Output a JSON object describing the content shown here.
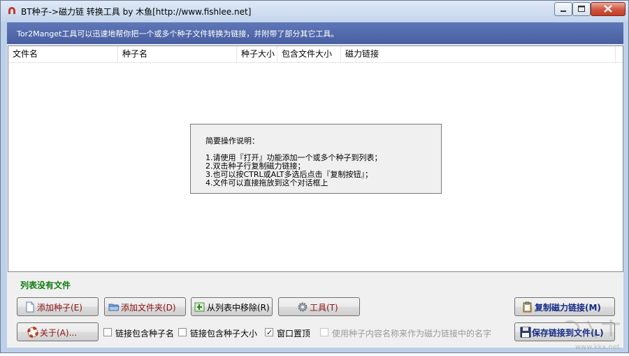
{
  "window": {
    "title": "BT种子->磁力链 转换工具 by 木鱼[http://www.fishlee.net]",
    "controls": {
      "minimize": "minimize",
      "maximize": "maximize",
      "close": "close"
    }
  },
  "banner": {
    "text": "Tor2Manget工具可以迅速地帮你把一个或多个种子文件转换为链接，并附带了部分其它工具。"
  },
  "list": {
    "columns": [
      "文件名",
      "种子名",
      "种子大小",
      "包含文件大小",
      "磁力链接"
    ]
  },
  "help": {
    "title": "简要操作说明：",
    "lines": [
      "1.请使用『打开』功能添加一个或多个种子到列表；",
      "2.双击种子行复制磁力链接；",
      "3.也可以按CTRL或ALT多选后点击『复制按钮』；",
      "4.文件可以直接拖放到这个对话框上"
    ]
  },
  "status": {
    "text": "列表没有文件"
  },
  "buttons": {
    "add_torrent": "添加种子(E)",
    "add_folder": "添加文件夹(D)",
    "remove": "从列表中移除(R)",
    "tools": "工具(T)",
    "copy_magnet": "复制磁力链接(M)",
    "about": "关于(A)...",
    "save_links": "保存链接到文件(L)"
  },
  "options": {
    "include_torrent_name": {
      "label": "链接包含种子名",
      "checked": false
    },
    "include_torrent_size": {
      "label": "链接包含种子大小",
      "checked": false
    },
    "window_on_top": {
      "label": "窗口置顶",
      "checked": true
    },
    "use_content_name": {
      "label": "使用种子内容名称来作为磁力链接中的名字",
      "checked": false,
      "disabled": true
    }
  },
  "watermark": {
    "text": "www.kkx.net"
  },
  "icons": {
    "app": "magnet-icon",
    "add_torrent": "document-icon",
    "add_folder": "folder-icon",
    "remove": "remove-icon",
    "tools": "gear-icon",
    "copy": "clipboard-icon",
    "about": "lifebuoy-icon",
    "save": "floppy-disk-icon"
  }
}
